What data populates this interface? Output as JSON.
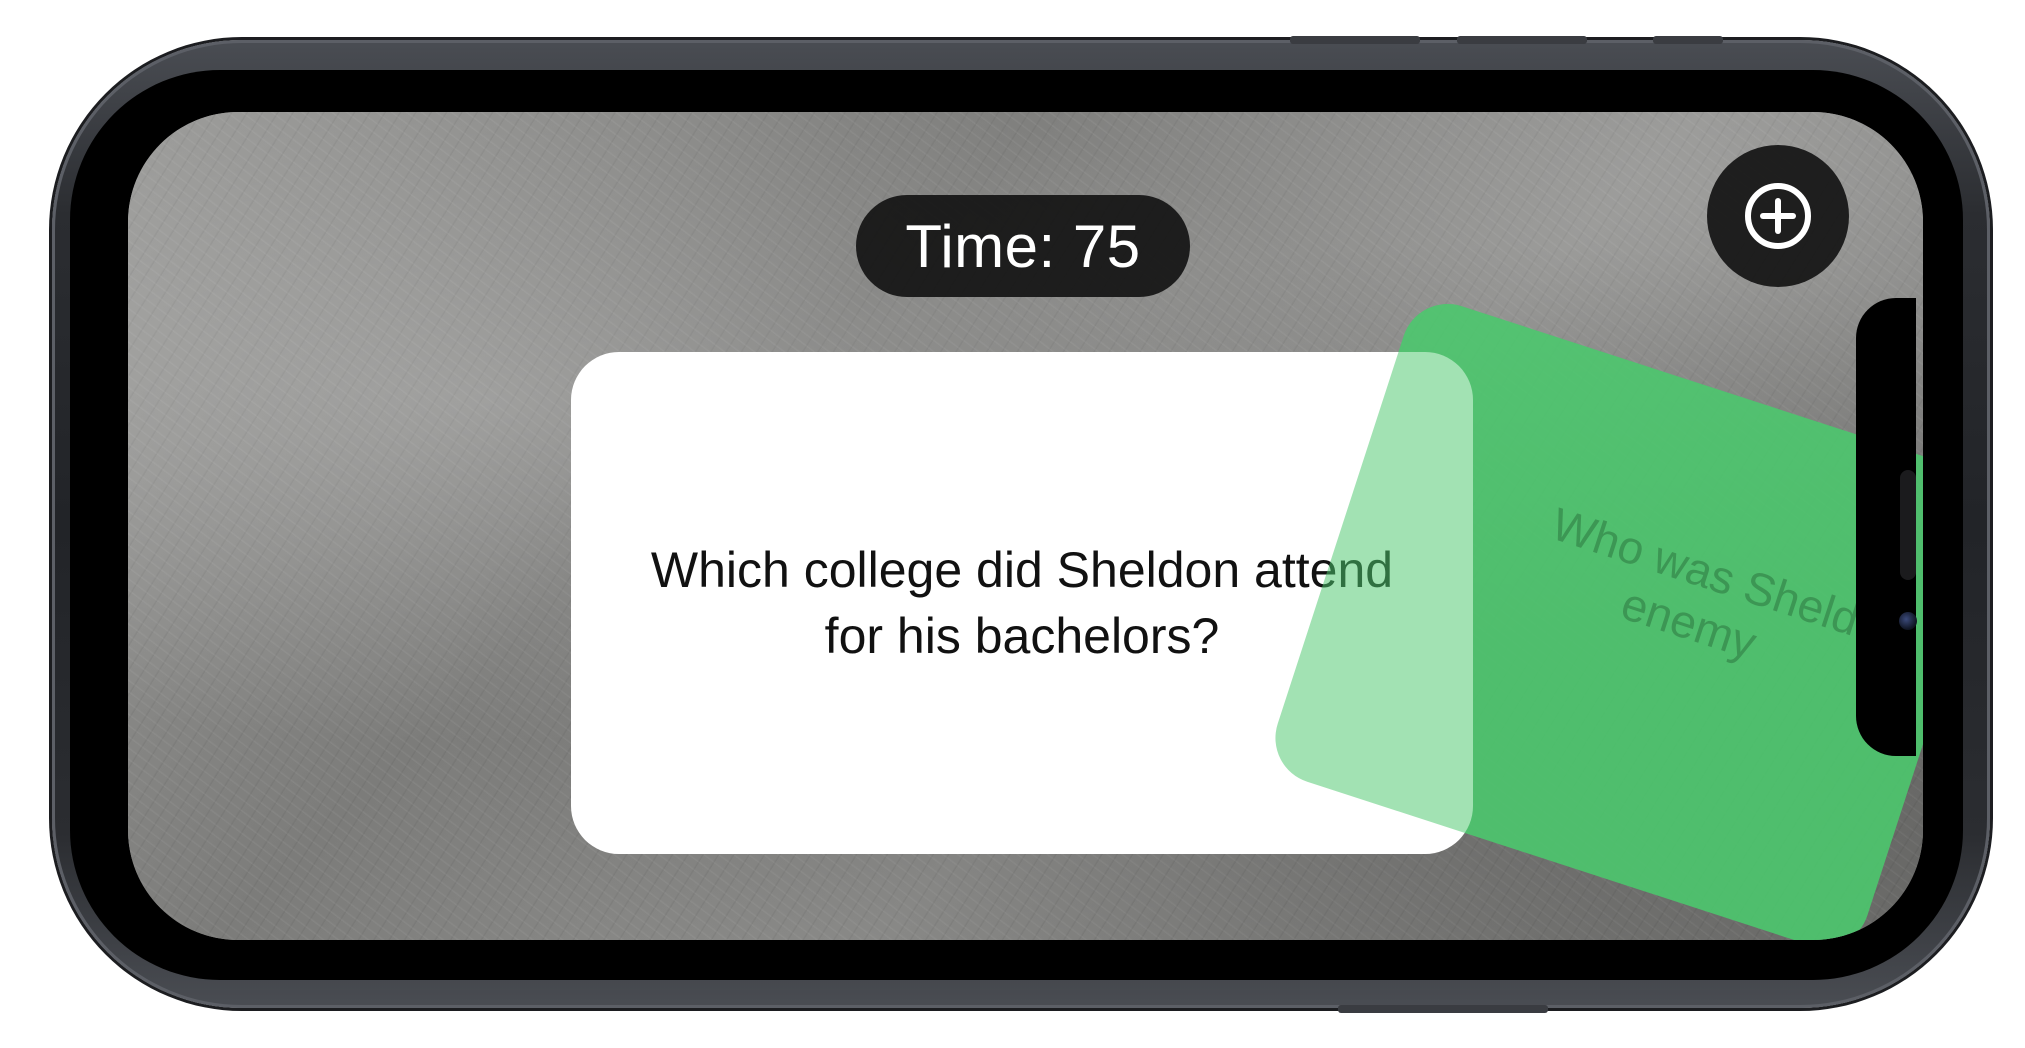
{
  "game": {
    "timer_text": "Time: 75",
    "add_button_icon": "plus-circle-icon"
  },
  "cards": {
    "front_question": "Which college did Sheldon attend\nfor his bachelors?",
    "back_question_partial": "Who was Sheld\nenemy"
  },
  "colors": {
    "card_green": "#4cc86e",
    "pill_background": "#141414",
    "card_front": "#ffffff"
  }
}
